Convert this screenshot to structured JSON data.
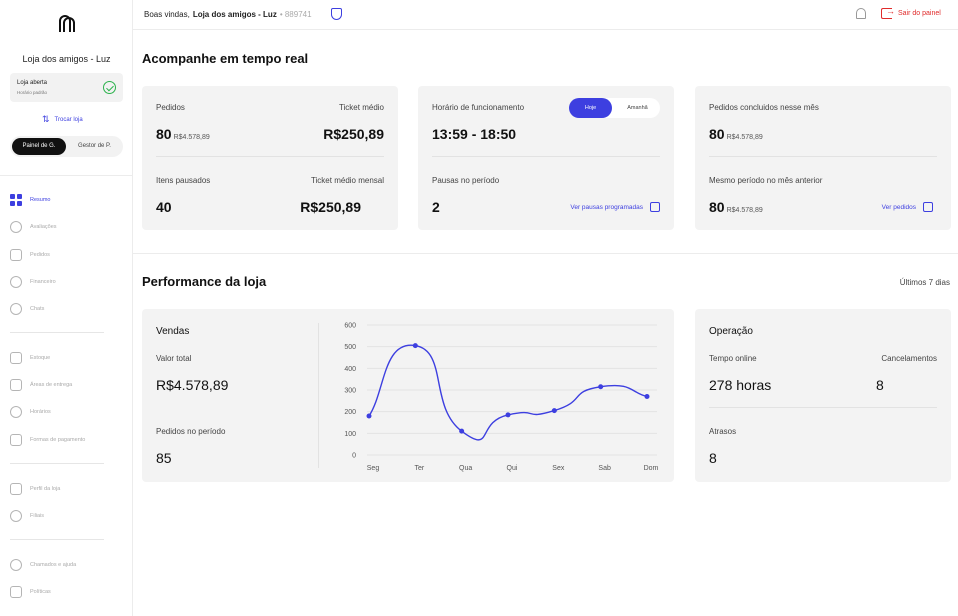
{
  "sidebar": {
    "store_name": "Loja dos amigos - Luz",
    "status_title": "Loja aberta",
    "status_sub": "Horário padrão",
    "swap_label": "Trocar loja",
    "toggle_active": "Painel de G.",
    "toggle_inactive": "Gestor de P.",
    "nav": [
      {
        "label": "Resumo",
        "icon": "grid-icon",
        "active": true
      },
      {
        "label": "Avaliações",
        "icon": "reviews-icon"
      },
      {
        "label": "Pedidos",
        "icon": "orders-icon"
      },
      {
        "label": "Financeiro",
        "icon": "money-icon"
      },
      {
        "label": "Chats",
        "icon": "chat-icon"
      },
      {
        "label": "Estoque",
        "icon": "stock-icon"
      },
      {
        "label": "Áreas de entrega",
        "icon": "map-icon"
      },
      {
        "label": "Horários",
        "icon": "clock-icon"
      },
      {
        "label": "Formas de pagamento",
        "icon": "card-icon"
      },
      {
        "label": "Perfil da loja",
        "icon": "profile-icon"
      },
      {
        "label": "Filiais",
        "icon": "branches-icon"
      },
      {
        "label": "Chamados e ajuda",
        "icon": "help-icon"
      },
      {
        "label": "Políticas",
        "icon": "policies-icon"
      }
    ]
  },
  "topbar": {
    "welcome": "Boas vindas,",
    "store": "Loja dos amigos - Luz",
    "store_id": "• 889741",
    "logout": "Sair do painel"
  },
  "realtime": {
    "title": "Acompanhe em tempo real",
    "card1": {
      "orders_label": "Pedidos",
      "orders_value": "80",
      "orders_amount": "R$4.578,89",
      "ticket_label": "Ticket médio",
      "ticket_value": "R$250,89",
      "paused_label": "Itens pausados",
      "paused_value": "40",
      "monthly_ticket_label": "Ticket médio mensal",
      "monthly_ticket_value": "R$250,89"
    },
    "card2": {
      "hours_label": "Horário de funcionamento",
      "toggle_today": "Hoje",
      "toggle_tomorrow": "Amanhã",
      "hours_value": "13:59 - 18:50",
      "pauses_label": "Pausas no período",
      "pauses_value": "2",
      "pauses_link": "Ver pausas programadas"
    },
    "card3": {
      "done_label": "Pedidos concluidos nesse mês",
      "done_value": "80",
      "done_amount": "R$4.578,89",
      "prev_label": "Mesmo período no mês anterior",
      "prev_value": "80",
      "prev_amount": "R$4.578,89",
      "orders_link": "Ver pedidos"
    }
  },
  "performance": {
    "title": "Performance da loja",
    "period": "Últimos 7 dias",
    "sales": {
      "title": "Vendas",
      "total_label": "Valor total",
      "total_value": "R$4.578,89",
      "orders_label": "Pedidos no período",
      "orders_value": "85"
    },
    "operation": {
      "title": "Operação",
      "online_label": "Tempo online",
      "online_value": "278 horas",
      "cancel_label": "Cancelamentos",
      "cancel_value": "8",
      "delays_label": "Atrasos",
      "delays_value": "8"
    }
  },
  "chart_data": {
    "type": "line",
    "categories": [
      "Seg",
      "Ter",
      "Qua",
      "Qui",
      "Sex",
      "Sab",
      "Dom"
    ],
    "x_positions": [
      0,
      1,
      2,
      3,
      4,
      5,
      6
    ],
    "values": [
      180,
      505,
      110,
      185,
      205,
      315,
      270
    ],
    "ylim": [
      0,
      600
    ],
    "yticks": [
      0,
      100,
      200,
      300,
      400,
      500,
      600
    ],
    "grid": true,
    "color": "#3d3fe0"
  }
}
